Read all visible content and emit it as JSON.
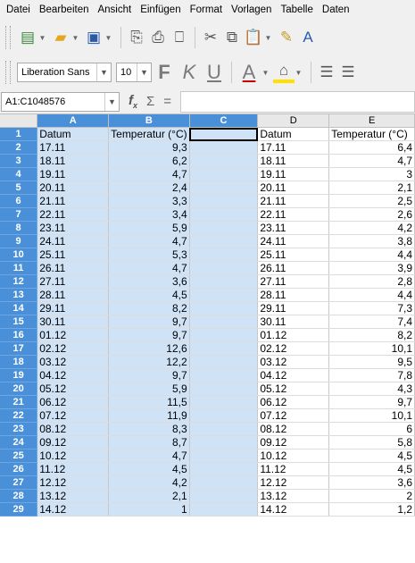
{
  "menu": [
    "Datei",
    "Bearbeiten",
    "Ansicht",
    "Einfügen",
    "Format",
    "Vorlagen",
    "Tabelle",
    "Daten"
  ],
  "font_name": "Liberation Sans",
  "font_size": "10",
  "name_box": "A1:C1048576",
  "formula_value": "",
  "colors": {
    "selection_header": "#4a90d9",
    "selection_fill": "#cfe2f6",
    "toolbar": "#f0f0f0"
  },
  "columns": [
    "A",
    "B",
    "C",
    "D",
    "E"
  ],
  "rows": [
    {
      "n": "1",
      "a": "Datum",
      "b": "Temperatur (°C)",
      "d": "Datum",
      "e": "Temperatur (°C)"
    },
    {
      "n": "2",
      "a": "17.11",
      "b": "9,3",
      "d": "17.11",
      "e": "6,4"
    },
    {
      "n": "3",
      "a": "18.11",
      "b": "6,2",
      "d": "18.11",
      "e": "4,7"
    },
    {
      "n": "4",
      "a": "19.11",
      "b": "4,7",
      "d": "19.11",
      "e": "3"
    },
    {
      "n": "5",
      "a": "20.11",
      "b": "2,4",
      "d": "20.11",
      "e": "2,1"
    },
    {
      "n": "6",
      "a": "21.11",
      "b": "3,3",
      "d": "21.11",
      "e": "2,5"
    },
    {
      "n": "7",
      "a": "22.11",
      "b": "3,4",
      "d": "22.11",
      "e": "2,6"
    },
    {
      "n": "8",
      "a": "23.11",
      "b": "5,9",
      "d": "23.11",
      "e": "4,2"
    },
    {
      "n": "9",
      "a": "24.11",
      "b": "4,7",
      "d": "24.11",
      "e": "3,8"
    },
    {
      "n": "10",
      "a": "25.11",
      "b": "5,3",
      "d": "25.11",
      "e": "4,4"
    },
    {
      "n": "11",
      "a": "26.11",
      "b": "4,7",
      "d": "26.11",
      "e": "3,9"
    },
    {
      "n": "12",
      "a": "27.11",
      "b": "3,6",
      "d": "27.11",
      "e": "2,8"
    },
    {
      "n": "13",
      "a": "28.11",
      "b": "4,5",
      "d": "28.11",
      "e": "4,4"
    },
    {
      "n": "14",
      "a": "29.11",
      "b": "8,2",
      "d": "29.11",
      "e": "7,3"
    },
    {
      "n": "15",
      "a": "30.11",
      "b": "9,7",
      "d": "30.11",
      "e": "7,4"
    },
    {
      "n": "16",
      "a": "01.12",
      "b": "9,7",
      "d": "01.12",
      "e": "8,2"
    },
    {
      "n": "17",
      "a": "02.12",
      "b": "12,6",
      "d": "02.12",
      "e": "10,1"
    },
    {
      "n": "18",
      "a": "03.12",
      "b": "12,2",
      "d": "03.12",
      "e": "9,5"
    },
    {
      "n": "19",
      "a": "04.12",
      "b": "9,7",
      "d": "04.12",
      "e": "7,8"
    },
    {
      "n": "20",
      "a": "05.12",
      "b": "5,9",
      "d": "05.12",
      "e": "4,3"
    },
    {
      "n": "21",
      "a": "06.12",
      "b": "11,5",
      "d": "06.12",
      "e": "9,7"
    },
    {
      "n": "22",
      "a": "07.12",
      "b": "11,9",
      "d": "07.12",
      "e": "10,1"
    },
    {
      "n": "23",
      "a": "08.12",
      "b": "8,3",
      "d": "08.12",
      "e": "6"
    },
    {
      "n": "24",
      "a": "09.12",
      "b": "8,7",
      "d": "09.12",
      "e": "5,8"
    },
    {
      "n": "25",
      "a": "10.12",
      "b": "4,7",
      "d": "10.12",
      "e": "4,5"
    },
    {
      "n": "26",
      "a": "11.12",
      "b": "4,5",
      "d": "11.12",
      "e": "4,5"
    },
    {
      "n": "27",
      "a": "12.12",
      "b": "4,2",
      "d": "12.12",
      "e": "3,6"
    },
    {
      "n": "28",
      "a": "13.12",
      "b": "2,1",
      "d": "13.12",
      "e": "2"
    },
    {
      "n": "29",
      "a": "14.12",
      "b": "1",
      "d": "14.12",
      "e": "1,2"
    }
  ]
}
